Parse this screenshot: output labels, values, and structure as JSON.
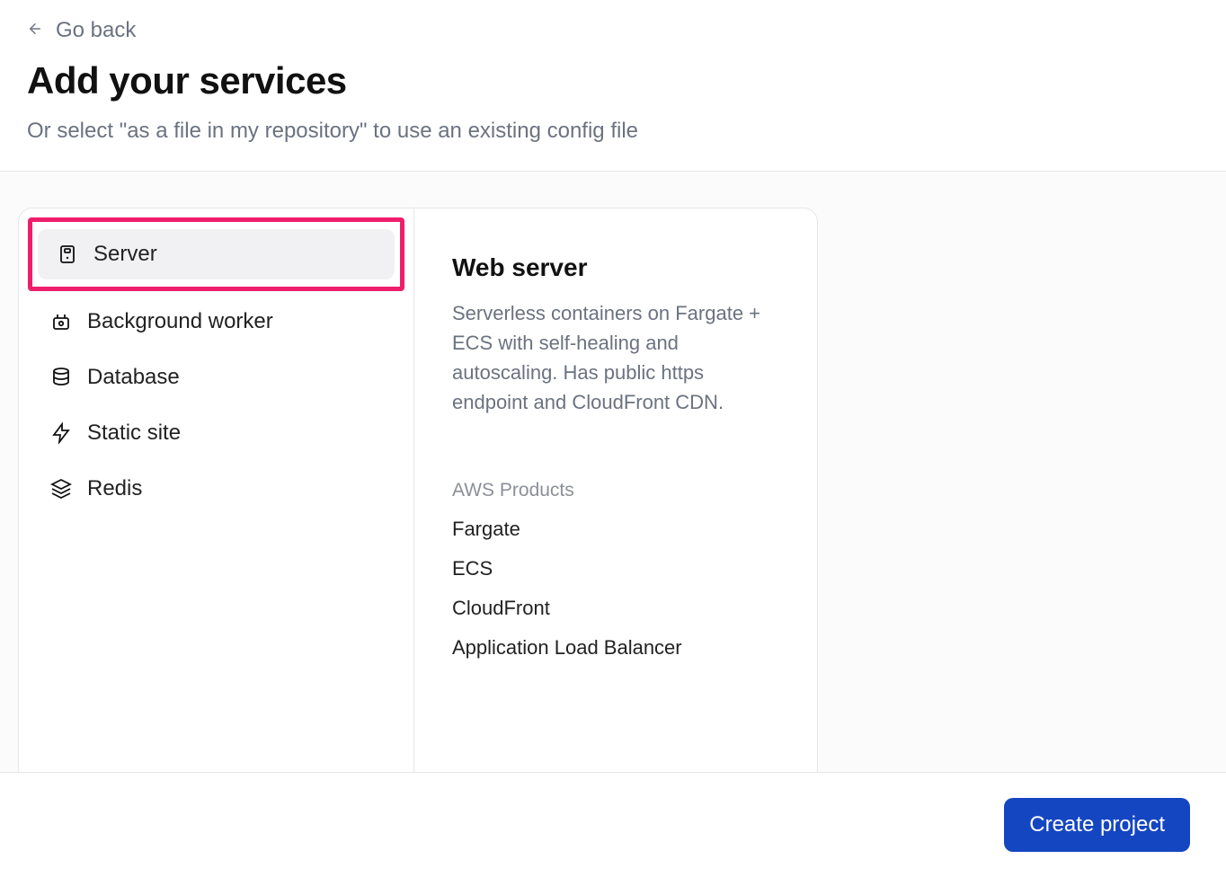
{
  "nav": {
    "go_back_label": "Go back"
  },
  "header": {
    "title": "Add your services",
    "subtitle": "Or select \"as a file in my repository\" to use an existing config file"
  },
  "services": [
    {
      "label": "Server",
      "selected": true,
      "icon": "server-icon"
    },
    {
      "label": "Background worker",
      "selected": false,
      "icon": "worker-icon"
    },
    {
      "label": "Database",
      "selected": false,
      "icon": "database-icon"
    },
    {
      "label": "Static site",
      "selected": false,
      "icon": "lightning-icon"
    },
    {
      "label": "Redis",
      "selected": false,
      "icon": "layers-icon"
    }
  ],
  "detail": {
    "title": "Web server",
    "description": "Serverless containers on Fargate + ECS with self-healing and autoscaling. Has public https endpoint and CloudFront CDN.",
    "products_label": "AWS Products",
    "products": [
      "Fargate",
      "ECS",
      "CloudFront",
      "Application Load Balancer"
    ]
  },
  "footer": {
    "create_label": "Create project"
  }
}
